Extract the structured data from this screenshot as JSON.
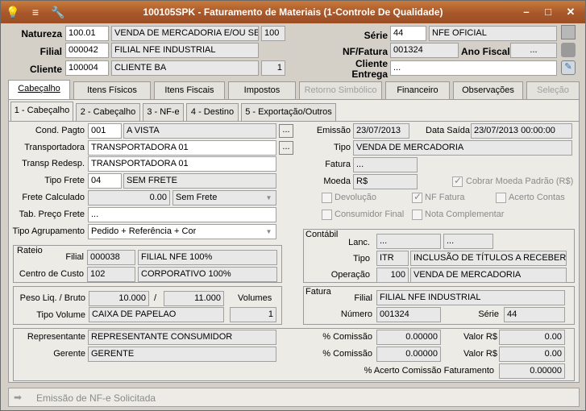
{
  "title": "100105SPK - Faturamento de Materiais (1-Controle De Qualidade)",
  "header": {
    "natureza_label": "Natureza",
    "natureza_code": "100.01",
    "natureza_desc": "VENDA DE MERCADORIA E/OU SERVI",
    "natureza_num": "100",
    "filial_label": "Filial",
    "filial_code": "000042",
    "filial_desc": "FILIAL NFE INDUSTRIAL",
    "cliente_label": "Cliente",
    "cliente_code": "100004",
    "cliente_desc": "CLIENTE BA",
    "cliente_num": "1",
    "serie_label": "Série",
    "serie_code": "44",
    "serie_desc": "NFE OFICIAL",
    "nf_label": "NF/Fatura",
    "nf_value": "001324",
    "ano_label": "Ano Fiscal",
    "ano_value": "...",
    "entrega_label_1": "Cliente",
    "entrega_label_2": "Entrega",
    "entrega_value": "..."
  },
  "tabs": [
    "Cabeçalho",
    "Itens Físicos",
    "Itens Fiscais",
    "Impostos",
    "Retorno Simbólico",
    "Financeiro",
    "Observações",
    "Seleção"
  ],
  "subtabs": [
    "1 - Cabeçalho",
    "2 - Cabeçalho",
    "3 - NF-e",
    "4 - Destino",
    "5 - Exportação/Outros"
  ],
  "form": {
    "cond_label": "Cond. Pagto",
    "cond_code": "001",
    "cond_desc": "A VISTA",
    "transp_label": "Transportadora",
    "transp_value": "TRANSPORTADORA 01",
    "redesp_label": "Transp Redesp.",
    "redesp_value": "TRANSPORTADORA 01",
    "tipofrete_label": "Tipo Frete",
    "tipofrete_code": "04",
    "tipofrete_desc": "SEM FRETE",
    "fretecalc_label": "Frete Calculado",
    "fretecalc_value": "0.00",
    "fretecalc_select": "Sem Frete",
    "tabpreco_label": "Tab. Preço Frete",
    "tabpreco_value": "...",
    "agrup_label": "Tipo Agrupamento",
    "agrup_value": "Pedido + Referência + Cor",
    "emissao_label": "Emissão",
    "emissao_value": "23/07/2013",
    "datasaida_label": "Data Saída",
    "datasaida_value": "23/07/2013 00:00:00",
    "tipo_label": "Tipo",
    "tipo_value": "VENDA DE MERCADORIA",
    "fatura_label": "Fatura",
    "fatura_value": "...",
    "moeda_label": "Moeda",
    "moeda_value": "R$",
    "cobrar_label": "Cobrar Moeda Padrão (R$)",
    "devolucao_label": "Devolução",
    "nffatura_label": "NF Fatura",
    "acerto_label": "Acerto Contas",
    "consumidor_label": "Consumidor Final",
    "notacompl_label": "Nota Complementar"
  },
  "rateio": {
    "title": "Rateio",
    "filial_label": "Filial",
    "filial_code": "000038",
    "filial_desc": "FILIAL NFE 100%",
    "cc_label": "Centro de Custo",
    "cc_code": "102",
    "cc_desc": "CORPORATIVO 100%"
  },
  "contabil": {
    "title": "Contábil",
    "lanc_label": "Lanc.",
    "lanc_a": "...",
    "lanc_b": "...",
    "tipo_label": "Tipo",
    "tipo_code": "ITR",
    "tipo_desc": "INCLUSÃO DE TÍTULOS A RECEBER",
    "op_label": "Operação",
    "op_code": "100",
    "op_desc": "VENDA DE MERCADORIA"
  },
  "volumes": {
    "peso_label": "Peso Liq. / Bruto",
    "peso_liq": "10.000",
    "slash": "/",
    "peso_bruto": "11.000",
    "volumes_label": "Volumes",
    "tipovol_label": "Tipo Volume",
    "tipovol_value": "CAIXA DE PAPELAO",
    "volumes_value": "1"
  },
  "fatura": {
    "title": "Fatura",
    "filial_label": "Filial",
    "filial_value": "FILIAL NFE INDUSTRIAL",
    "numero_label": "Número",
    "numero_value": "001324",
    "serie_label": "Série",
    "serie_value": "44"
  },
  "comissao": {
    "rep_label": "Representante",
    "rep_value": "REPRESENTANTE CONSUMIDOR",
    "ger_label": "Gerente",
    "ger_value": "GERENTE",
    "pct_label": "% Comissão",
    "pct1": "0.00000",
    "pct2": "0.00000",
    "valor_label": "Valor R$",
    "valor1": "0.00",
    "valor2": "0.00",
    "acerto_label": "% Acerto Comissão Faturamento",
    "acerto_value": "0.00000"
  },
  "status": {
    "text": "Emissão de NF-e Solicitada"
  }
}
